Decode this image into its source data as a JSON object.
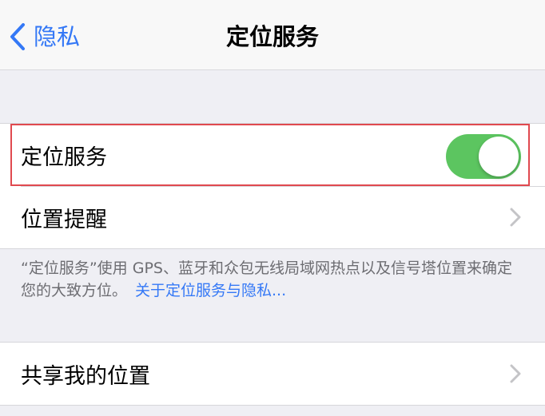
{
  "nav": {
    "back_label": "隐私",
    "title": "定位服务"
  },
  "settings": {
    "location_services": {
      "label": "定位服务",
      "enabled": true
    },
    "location_alerts": {
      "label": "位置提醒"
    },
    "share_my_location": {
      "label": "共享我的位置"
    }
  },
  "footer": {
    "description": "“定位服务”使用 GPS、蓝牙和众包无线局域网热点以及信号塔位置来确定您的大致方位。",
    "link": "关于定位服务与隐私..."
  },
  "colors": {
    "accent": "#3478f6",
    "toggle_on": "#5cc560",
    "highlight_box": "#e0494f"
  }
}
